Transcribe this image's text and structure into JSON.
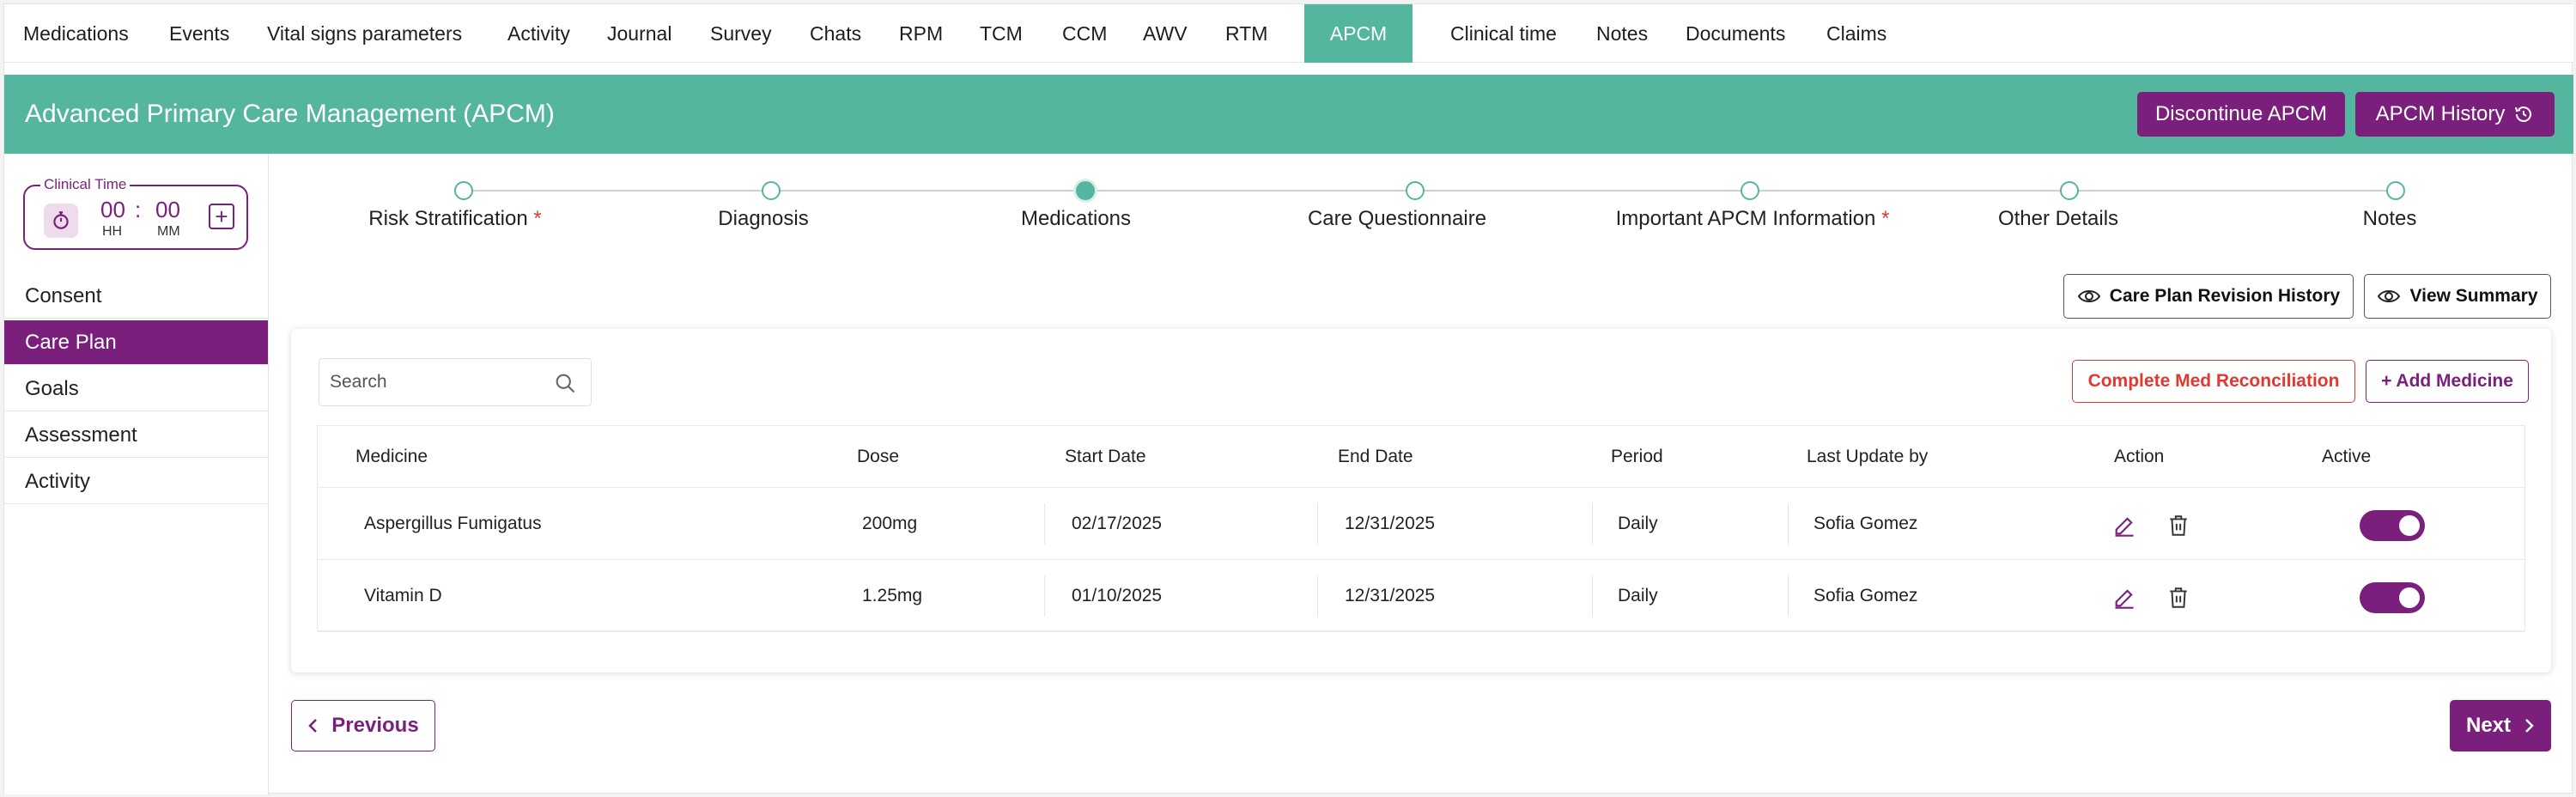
{
  "tabs": [
    "Medications",
    "Events",
    "Vital signs parameters",
    "Activity",
    "Journal",
    "Survey",
    "Chats",
    "RPM",
    "TCM",
    "CCM",
    "AWV",
    "RTM",
    "APCM",
    "Clinical time",
    "Notes",
    "Documents",
    "Claims"
  ],
  "active_tab": "APCM",
  "header": {
    "title": "Advanced Primary Care Management (APCM)",
    "discontinue_label": "Discontinue APCM",
    "history_label": "APCM History"
  },
  "clinical_time": {
    "label": "Clinical Time",
    "hours": "00",
    "separator": ":",
    "minutes": "00",
    "hours_unit": "HH",
    "minutes_unit": "MM",
    "add_symbol": "+"
  },
  "sidebar": {
    "items": [
      "Consent",
      "Care Plan",
      "Goals",
      "Assessment",
      "Activity"
    ],
    "active": "Care Plan"
  },
  "stepper": {
    "steps": [
      {
        "label": "Risk Stratification",
        "required": "*"
      },
      {
        "label": "Diagnosis",
        "required": ""
      },
      {
        "label": "Medications",
        "required": ""
      },
      {
        "label": "Care Questionnaire",
        "required": ""
      },
      {
        "label": "Important APCM Information",
        "required": "*"
      },
      {
        "label": "Other Details",
        "required": ""
      },
      {
        "label": "Notes",
        "required": ""
      }
    ],
    "current": "Medications"
  },
  "actions": {
    "revision_history": "Care Plan Revision History",
    "view_summary": "View Summary",
    "search_placeholder": "Search",
    "complete_reconciliation": "Complete Med Reconciliation",
    "add_medicine": "+ Add Medicine"
  },
  "table": {
    "columns": [
      "Medicine",
      "Dose",
      "Start Date",
      "End Date",
      "Period",
      "Last Update by",
      "Action",
      "Active"
    ],
    "rows": [
      {
        "medicine": "Aspergillus Fumigatus",
        "dose": "200mg",
        "start": "02/17/2025",
        "end": "12/31/2025",
        "period": "Daily",
        "updated_by": "Sofia Gomez",
        "active": true
      },
      {
        "medicine": "Vitamin D",
        "dose": "1.25mg",
        "start": "01/10/2025",
        "end": "12/31/2025",
        "period": "Daily",
        "updated_by": "Sofia Gomez",
        "active": true
      }
    ]
  },
  "nav": {
    "previous": "Previous",
    "next": "Next"
  },
  "colors": {
    "accent_green": "#55b6a0",
    "brand_purple": "#7b1f7c",
    "danger_red": "#e0392f"
  },
  "icons": [
    "history-icon",
    "stopwatch-icon",
    "plus-icon",
    "eye-icon",
    "search-icon",
    "edit-icon",
    "trash-icon",
    "chevron-left-icon",
    "chevron-right-icon"
  ]
}
